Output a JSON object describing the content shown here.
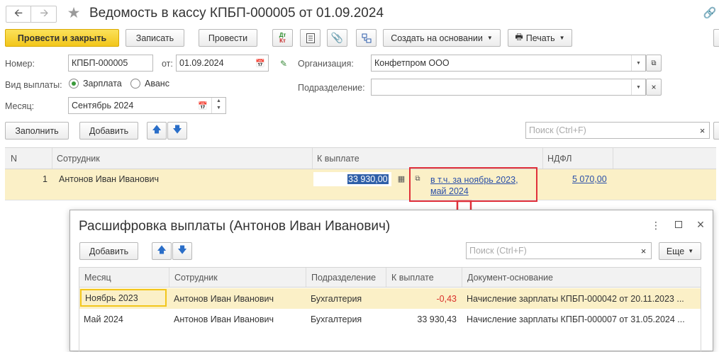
{
  "document": {
    "title": "Ведомость в кассу КПБП-000005 от 01.09.2024"
  },
  "toolbar": {
    "post_close": "Провести и закрыть",
    "save": "Записать",
    "post": "Провести",
    "create_based": "Создать на основании",
    "print": "Печать"
  },
  "form": {
    "number_label": "Номер:",
    "number_value": "КПБП-000005",
    "from_label": "от:",
    "date_value": "01.09.2024",
    "org_label": "Организация:",
    "org_value": "Конфетпром ООО",
    "pay_type_label": "Вид выплаты:",
    "pay_type_options": [
      "Зарплата",
      "Аванс"
    ],
    "pay_type_selected": "Зарплата",
    "department_label": "Подразделение:",
    "department_value": "",
    "month_label": "Месяц:",
    "month_value": "Сентябрь 2024"
  },
  "table_toolbar": {
    "fill": "Заполнить",
    "add": "Добавить",
    "search_placeholder": "Поиск (Ctrl+F)"
  },
  "table": {
    "columns": [
      "N",
      "Сотрудник",
      "К выплате",
      "НДФЛ"
    ],
    "rows": [
      {
        "n": "1",
        "employee": "Антонов Иван Иванович",
        "amount": "33 930,00",
        "detail_line1": "в т.ч. за ноябрь 2023,",
        "detail_line2": "май 2024",
        "ndfl": "5 070,00"
      }
    ]
  },
  "dialog": {
    "title": "Расшифровка выплаты (Антонов Иван Иванович)",
    "add": "Добавить",
    "search_placeholder": "Поиск (Ctrl+F)",
    "more": "Еще",
    "columns": [
      "Месяц",
      "Сотрудник",
      "Подразделение",
      "К выплате",
      "Документ-основание"
    ],
    "rows": [
      {
        "month": "Ноябрь 2023",
        "employee": "Антонов Иван Иванович",
        "department": "Бухгалтерия",
        "amount": "-0,43",
        "basis": "Начисление зарплаты КПБП-000042 от 20.11.2023 ..."
      },
      {
        "month": "Май 2024",
        "employee": "Антонов Иван Иванович",
        "department": "Бухгалтерия",
        "amount": "33 930,43",
        "basis": "Начисление зарплаты КПБП-000007 от 31.05.2024 ..."
      }
    ]
  },
  "colors": {
    "accent_yellow": "#f2c61b",
    "selected_row": "#fbf0c7",
    "link": "#2a4fa8",
    "negative": "#d9302b",
    "highlight": "#e0303a"
  }
}
